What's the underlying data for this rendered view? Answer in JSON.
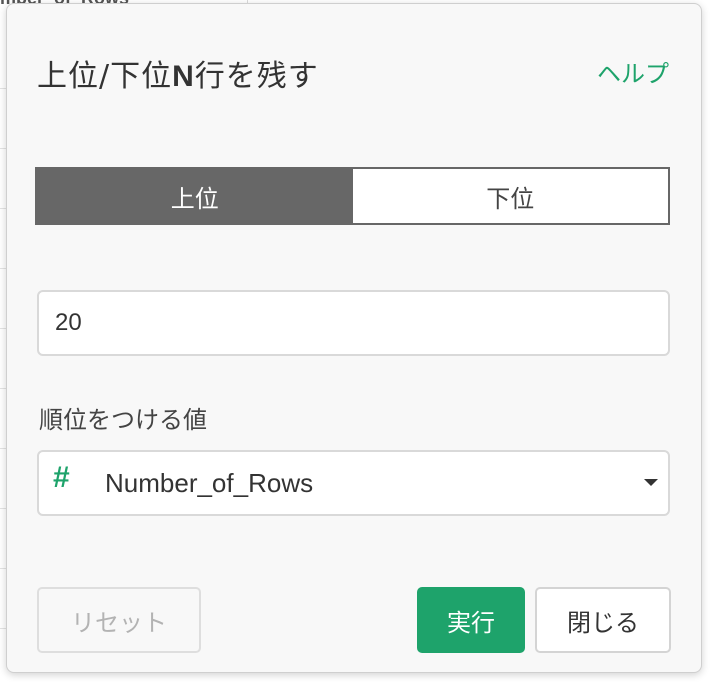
{
  "background": {
    "column_header": "mber_of_Rows"
  },
  "dialog": {
    "title_prefix": "上位/下位",
    "title_n": "N",
    "title_suffix": "行を残す",
    "help_label": "ヘルプ",
    "toggle": {
      "options": [
        {
          "label": "上位",
          "selected": true
        },
        {
          "label": "下位",
          "selected": false
        }
      ]
    },
    "count_input": {
      "value": "20"
    },
    "rank_by": {
      "label": "順位をつける値",
      "column_type_icon": "#",
      "selected_value": "Number_of_Rows"
    },
    "buttons": {
      "reset": "リセット",
      "run": "実行",
      "close": "閉じる"
    }
  },
  "colors": {
    "accent": "#1ea36b",
    "toggle_active_bg": "#676767",
    "panel_bg": "#f8f8f8"
  }
}
